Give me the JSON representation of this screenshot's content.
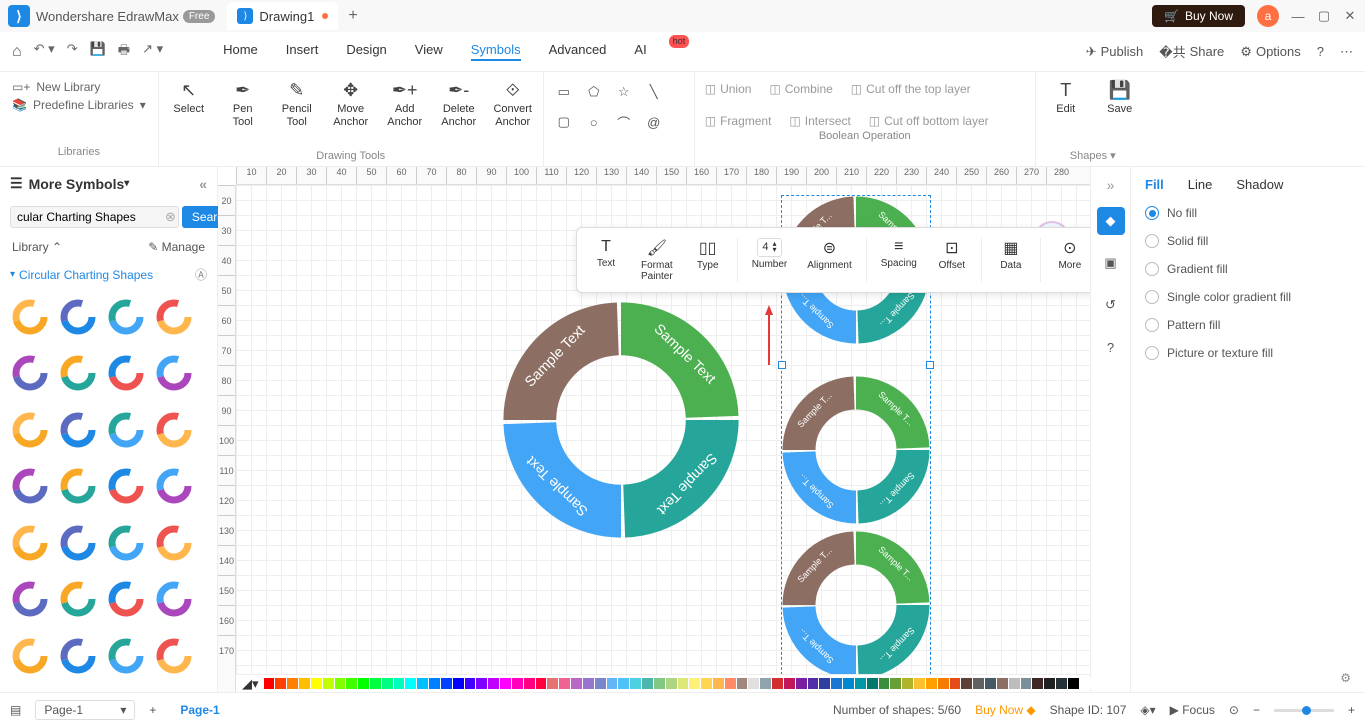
{
  "titlebar": {
    "app_name": "Wondershare EdrawMax",
    "free": "Free",
    "tab_name": "Drawing1",
    "buy_now": "Buy Now",
    "avatar": "a"
  },
  "menubar": {
    "items": [
      "Home",
      "Insert",
      "Design",
      "View",
      "Symbols",
      "Advanced",
      "AI"
    ],
    "active": "Symbols",
    "right": {
      "publish": "Publish",
      "share": "Share",
      "options": "Options"
    }
  },
  "ribbon": {
    "libraries": {
      "new": "New Library",
      "predef": "Predefine Libraries",
      "label": "Libraries"
    },
    "drawing": {
      "select": "Select",
      "pen": "Pen\nTool",
      "pencil": "Pencil\nTool",
      "move": "Move\nAnchor",
      "add": "Add\nAnchor",
      "del": "Delete\nAnchor",
      "conv": "Convert\nAnchor",
      "label": "Drawing Tools"
    },
    "boolean": {
      "union": "Union",
      "combine": "Combine",
      "cuttop": "Cut off the top layer",
      "fragment": "Fragment",
      "intersect": "Intersect",
      "cutbot": "Cut off bottom layer",
      "label": "Boolean Operation"
    },
    "edit": "Edit",
    "save": "Save",
    "shapes": "Shapes"
  },
  "left": {
    "more": "More Symbols",
    "search_value": "cular Charting Shapes",
    "search_btn": "Search",
    "library": "Library",
    "manage": "Manage",
    "section": "Circular Charting Shapes"
  },
  "float": {
    "text": "Text",
    "fmt": "Format\nPainter",
    "type": "Type",
    "number": "Number",
    "num_val": "4",
    "align": "Alignment",
    "spacing": "Spacing",
    "offset": "Offset",
    "data": "Data",
    "more": "More"
  },
  "props": {
    "tabs": [
      "Fill",
      "Line",
      "Shadow"
    ],
    "options": [
      "No fill",
      "Solid fill",
      "Gradient fill",
      "Single color gradient fill",
      "Pattern fill",
      "Picture or texture fill"
    ],
    "checked": 0
  },
  "status": {
    "page": "Page-1",
    "page_tab": "Page-1",
    "shapes_count": "Number of shapes: 5/60",
    "buy": "Buy Now",
    "shape_id": "Shape ID: 107",
    "focus": "Focus"
  },
  "ruler_h": [
    "10",
    "20",
    "30",
    "40",
    "50",
    "60",
    "70",
    "80",
    "90",
    "100",
    "110",
    "120",
    "130",
    "140",
    "150",
    "160",
    "170",
    "180",
    "190",
    "200",
    "210",
    "220",
    "230",
    "240",
    "250",
    "260",
    "270",
    "280"
  ],
  "ruler_v": [
    "20",
    "30",
    "40",
    "50",
    "60",
    "70",
    "80",
    "90",
    "100",
    "110",
    "120",
    "130",
    "140",
    "150",
    "160",
    "170"
  ],
  "donut_labels": [
    "Sample Text",
    "Sample Text",
    "Sample Text",
    "Sample Text"
  ],
  "small_donut_labels": [
    "Sample T...",
    "Sample T...",
    "Sample T...",
    "Sample T..."
  ],
  "colors": [
    "#ff0000",
    "#ff4000",
    "#ff8000",
    "#ffbf00",
    "#ffff00",
    "#bfff00",
    "#80ff00",
    "#40ff00",
    "#00ff00",
    "#00ff40",
    "#00ff80",
    "#00ffbf",
    "#00ffff",
    "#00bfff",
    "#0080ff",
    "#0040ff",
    "#0000ff",
    "#4000ff",
    "#8000ff",
    "#bf00ff",
    "#ff00ff",
    "#ff00bf",
    "#ff0080",
    "#ff0040",
    "#e57373",
    "#f06292",
    "#ba68c8",
    "#9575cd",
    "#7986cb",
    "#64b5f6",
    "#4fc3f7",
    "#4dd0e1",
    "#4db6ac",
    "#81c784",
    "#aed581",
    "#dce775",
    "#fff176",
    "#ffd54f",
    "#ffb74d",
    "#ff8a65",
    "#a1887f",
    "#e0e0e0",
    "#90a4ae",
    "#d32f2f",
    "#c2185b",
    "#7b1fa2",
    "#512da8",
    "#303f9f",
    "#1976d2",
    "#0288d1",
    "#0097a7",
    "#00796b",
    "#388e3c",
    "#689f38",
    "#afb42b",
    "#fbc02d",
    "#ffa000",
    "#f57c00",
    "#e64a19",
    "#5d4037",
    "#616161",
    "#455a64",
    "#8d6e63",
    "#bdbdbd",
    "#78909c",
    "#3e2723",
    "#212121",
    "#263238",
    "#000000",
    "#ffffff"
  ]
}
